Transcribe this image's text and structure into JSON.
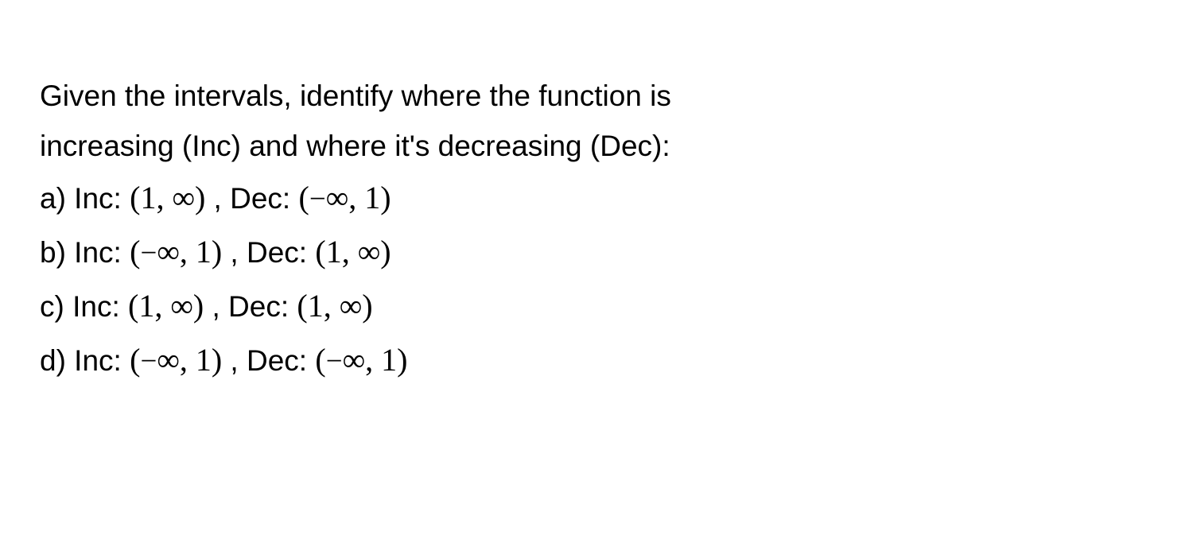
{
  "question": {
    "line1": "Given the intervals, identify where the function is",
    "line2": "increasing (Inc) and where it's decreasing (Dec):"
  },
  "options": {
    "a": {
      "label": "a) Inc: ",
      "inc_open": "(",
      "inc_val1": "1",
      "inc_comma": ", ",
      "inc_val2": "∞",
      "inc_close": ")",
      "mid": " , Dec: ",
      "dec_open": "(",
      "dec_minus": "−",
      "dec_val1": "∞",
      "dec_comma": ", ",
      "dec_val2": "1",
      "dec_close": ")"
    },
    "b": {
      "label": "b) Inc: ",
      "inc_open": "(",
      "inc_minus": "−",
      "inc_val1": "∞",
      "inc_comma": ", ",
      "inc_val2": "1",
      "inc_close": ")",
      "mid": " , Dec: ",
      "dec_open": "(",
      "dec_val1": "1",
      "dec_comma": ", ",
      "dec_val2": "∞",
      "dec_close": ")"
    },
    "c": {
      "label": "c) Inc: ",
      "inc_open": "(",
      "inc_val1": "1",
      "inc_comma": ", ",
      "inc_val2": "∞",
      "inc_close": ")",
      "mid": " , Dec: ",
      "dec_open": "(",
      "dec_val1": "1",
      "dec_comma": ", ",
      "dec_val2": "∞",
      "dec_close": ")"
    },
    "d": {
      "label": "d) Inc: ",
      "inc_open": "(",
      "inc_minus": "−",
      "inc_val1": "∞",
      "inc_comma": ", ",
      "inc_val2": "1",
      "inc_close": ")",
      "mid": " , Dec: ",
      "dec_open": "(",
      "dec_minus": "−",
      "dec_val1": "∞",
      "dec_comma": ", ",
      "dec_val2": "1",
      "dec_close": ")"
    }
  }
}
